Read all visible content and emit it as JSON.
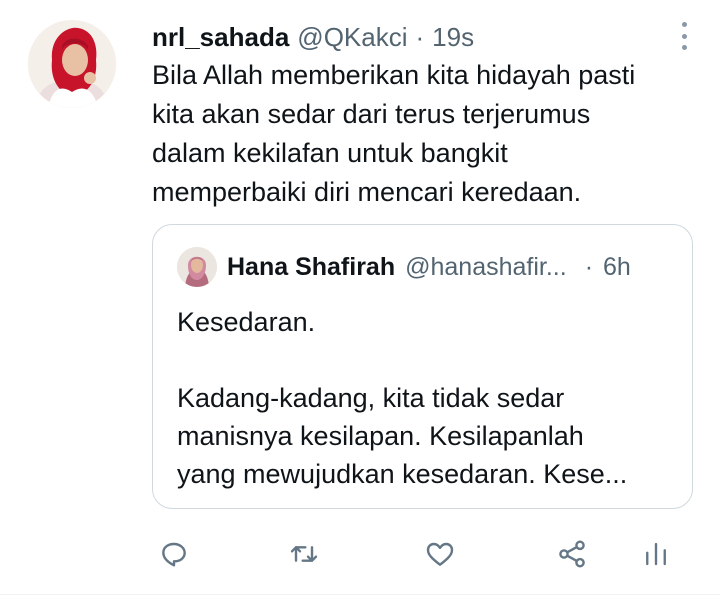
{
  "tweet": {
    "display_name": "nrl_sahada",
    "handle": "@QKakci",
    "separator": "·",
    "time": "19s",
    "text": "Bila Allah memberikan kita hidayah pasti\nkita akan sedar dari terus terjerumus\ndalam kekilafan untuk bangkit\nmemperbaiki diri mencari keredaan."
  },
  "quoted_tweet": {
    "display_name": "Hana Shafirah",
    "handle": "@hanashafir...",
    "separator": "·",
    "time": "6h",
    "text": "Kesedaran.\n\nKadang-kadang, kita tidak sedar\nmanisnya kesilapan. Kesilapanlah\nyang mewujudkan kesedaran. Kese..."
  },
  "actions": {
    "icons": [
      "reply-icon",
      "retweet-icon",
      "like-icon",
      "share-icon",
      "analytics-icon"
    ]
  },
  "colors": {
    "text_primary": "#0f1419",
    "text_secondary": "#536471",
    "icon_gray": "#657786",
    "border": "#cfd9de",
    "avatar_hijab": "#c7142b"
  }
}
